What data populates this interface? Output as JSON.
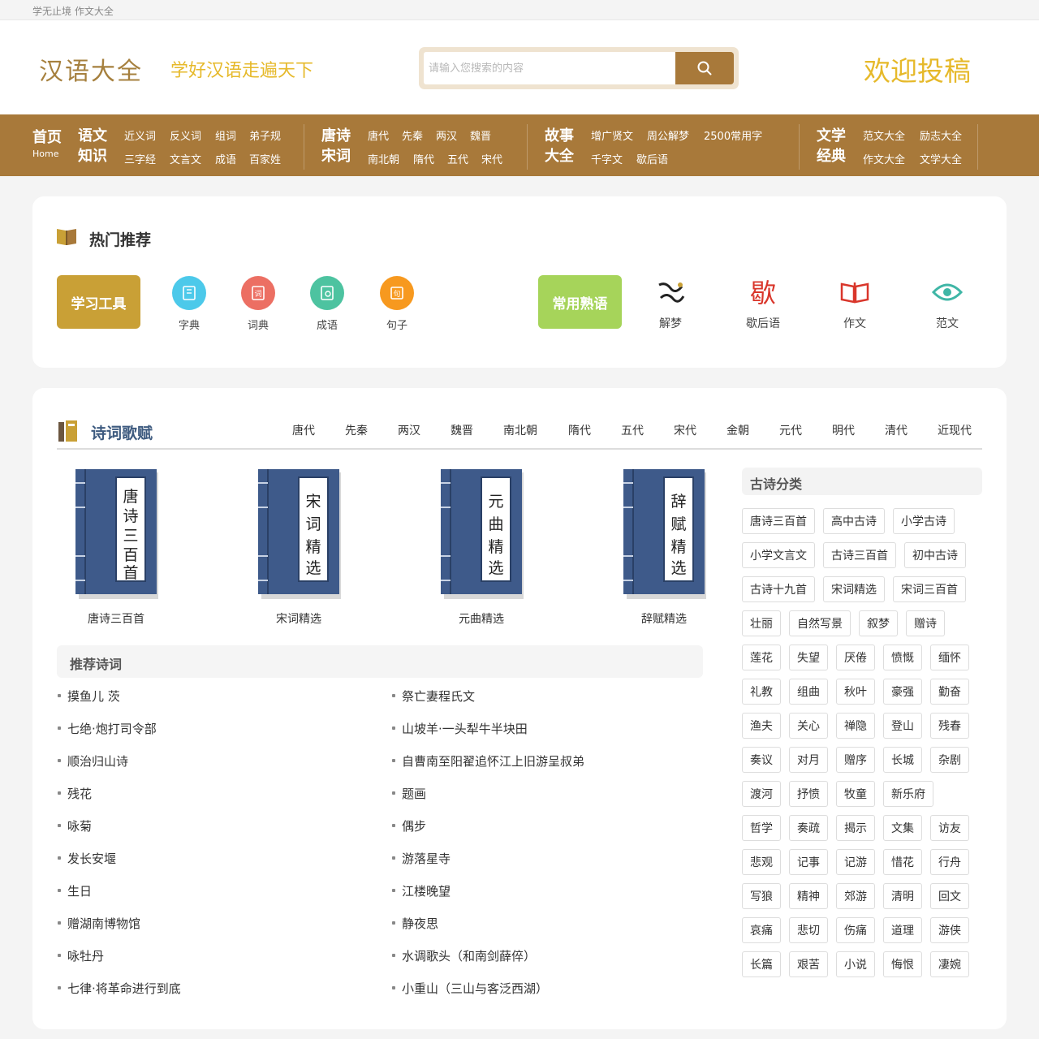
{
  "topbar": {
    "text": "学无止境 作文大全"
  },
  "header": {
    "site_title": "汉语大全",
    "slogan": "学好汉语走遍天下",
    "search_placeholder": "请输入您搜索的内容",
    "welcome": "欢迎投稿"
  },
  "nav": {
    "home": {
      "label": "首页",
      "sub": "Home"
    },
    "groups": [
      {
        "title": [
          "语文",
          "知识"
        ],
        "links": [
          [
            "近义词",
            "反义词",
            "组词",
            "弟子规"
          ],
          [
            "三字经",
            "文言文",
            "成语",
            "百家姓"
          ]
        ]
      },
      {
        "title": [
          "唐诗",
          "宋词"
        ],
        "links": [
          [
            "唐代",
            "先秦",
            "两汉",
            "魏晋"
          ],
          [
            "南北朝",
            "隋代",
            "五代",
            "宋代"
          ]
        ]
      },
      {
        "title": [
          "故事",
          "大全"
        ],
        "links": [
          [
            "增广贤文",
            "周公解梦",
            "2500常用字"
          ],
          [
            "千字文",
            "歇后语"
          ]
        ]
      },
      {
        "title": [
          "文学",
          "经典"
        ],
        "links": [
          [
            "范文大全",
            "励志大全"
          ],
          [
            "作文大全",
            "文学大全"
          ]
        ]
      }
    ]
  },
  "hot": {
    "title": "热门推荐",
    "learn_btn": "学习工具",
    "tools": [
      {
        "label": "字典",
        "color": "#4cc9ea",
        "icon": "book-icon"
      },
      {
        "label": "词典",
        "color": "#ec6f63",
        "icon": "dictionary-icon"
      },
      {
        "label": "成语",
        "color": "#4dc3a0",
        "icon": "notebook-icon"
      },
      {
        "label": "句子",
        "color": "#f7991f",
        "icon": "sentence-icon"
      }
    ],
    "idiom_btn": "常用熟语",
    "idioms": [
      {
        "label": "解梦",
        "icon": "dream-icon"
      },
      {
        "label": "歇后语",
        "icon": "xiehouyu-icon"
      },
      {
        "label": "作文",
        "icon": "open-book-icon"
      },
      {
        "label": "范文",
        "icon": "eye-icon"
      }
    ],
    "colors": {
      "learn": "#c9a036",
      "idiom": "#a6d45a"
    }
  },
  "poetry": {
    "title": "诗词歌赋",
    "tabs": [
      "唐代",
      "先秦",
      "两汉",
      "魏晋",
      "南北朝",
      "隋代",
      "五代",
      "宋代",
      "金朝",
      "元代",
      "明代",
      "清代",
      "近现代"
    ],
    "books": [
      {
        "cover": "唐诗三百首",
        "label": "唐诗三百首"
      },
      {
        "cover": "宋词精选",
        "label": "宋词精选"
      },
      {
        "cover": "元曲精选",
        "label": "元曲精选"
      },
      {
        "cover": "辞赋精选",
        "label": "辞赋精选"
      }
    ],
    "recommend_title": "推荐诗词",
    "poems_left": [
      "摸鱼儿 茨",
      "七绝·炮打司令部",
      "顺治归山诗",
      "残花",
      "咏菊",
      "发长安堰",
      "生日",
      "赠湖南博物馆",
      "咏牡丹",
      "七律·将革命进行到底"
    ],
    "poems_right": [
      "祭亡妻程氏文",
      "山坡羊·一头犁牛半块田",
      "自曹南至阳翟追怀江上旧游呈叔弟",
      "题画",
      "偶步",
      "游落星寺",
      "江楼晚望",
      "静夜思",
      "水调歌头（和南剑薛倅）",
      "小重山（三山与客泛西湖）"
    ],
    "category_title": "古诗分类",
    "tag_rows": [
      [
        "唐诗三百首",
        "高中古诗",
        "小学古诗"
      ],
      [
        "小学文言文",
        "古诗三百首",
        "初中古诗"
      ],
      [
        "古诗十九首",
        "宋词精选",
        "宋词三百首"
      ],
      [
        "壮丽",
        "自然写景",
        "叙梦",
        "赠诗"
      ],
      [
        "莲花",
        "失望",
        "厌倦",
        "愤慨",
        "缅怀"
      ],
      [
        "礼教",
        "组曲",
        "秋叶",
        "豪强",
        "勤奋"
      ],
      [
        "渔夫",
        "关心",
        "禅隐",
        "登山",
        "残春"
      ],
      [
        "奏议",
        "对月",
        "赠序",
        "长城",
        "杂剧"
      ],
      [
        "渡河",
        "抒愤",
        "牧童",
        "新乐府"
      ],
      [
        "哲学",
        "奏疏",
        "揭示",
        "文集",
        "访友"
      ],
      [
        "悲观",
        "记事",
        "记游",
        "惜花",
        "行舟"
      ],
      [
        "写狼",
        "精神",
        "郊游",
        "清明",
        "回文"
      ],
      [
        "哀痛",
        "悲切",
        "伤痛",
        "道理",
        "游侠"
      ],
      [
        "长篇",
        "艰苦",
        "小说",
        "悔恨",
        "凄婉"
      ]
    ]
  }
}
